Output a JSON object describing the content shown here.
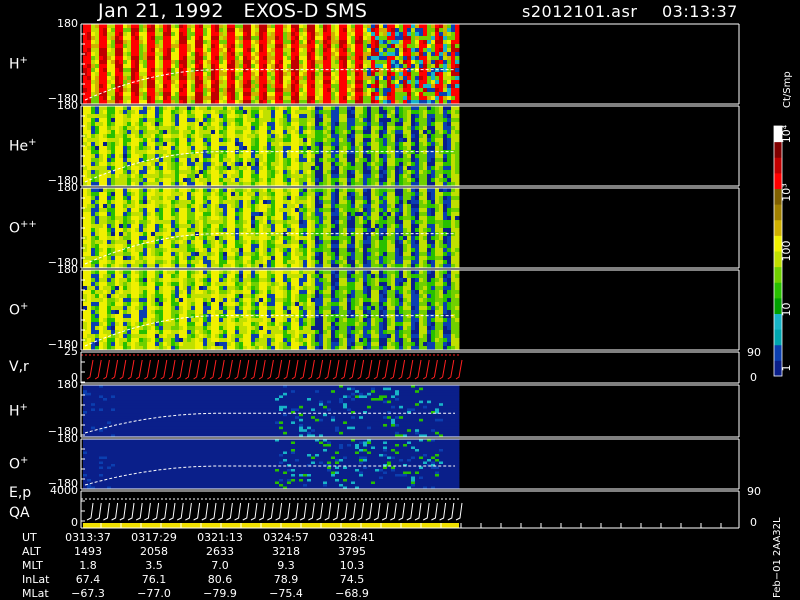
{
  "header": {
    "title": "Jan 21, 1992   EXOS-D SMS",
    "file": "s2012101.asr",
    "time": "03:13:37"
  },
  "colorbar": {
    "unit": "Ct/Smp",
    "ticks": [
      "1",
      "10",
      "100",
      "10³",
      "10⁴"
    ],
    "colors": [
      "#0a1f8a",
      "#0b3fb0",
      "#00a6b0",
      "#18b4c8",
      "#00a000",
      "#28c000",
      "#70d000",
      "#c0e000",
      "#f0f000",
      "#d0b000",
      "#a08000",
      "#806000",
      "#ff0000",
      "#c00000",
      "#800000",
      "#ffffff"
    ]
  },
  "panels": [
    {
      "id": "h-plus",
      "label": "H",
      "sup": "+",
      "ymax": "180",
      "ymin": "−180"
    },
    {
      "id": "he-plus",
      "label": "He",
      "sup": "+",
      "ymax": "180",
      "ymin": "−180"
    },
    {
      "id": "o-plus-plus",
      "label": "O",
      "sup": "++",
      "ymax": "180",
      "ymin": "−180"
    },
    {
      "id": "o-plus",
      "label": "O",
      "sup": "+",
      "ymax": "180",
      "ymin": "−180"
    },
    {
      "id": "v-r",
      "label": "V,r",
      "sup": "",
      "ymax": "25",
      "ymin": "0",
      "rmax": "90",
      "rmin": "0"
    },
    {
      "id": "h-plus-2",
      "label": "H",
      "sup": "+",
      "ymax": "180",
      "ymin": "−180"
    },
    {
      "id": "o-plus-2",
      "label": "O",
      "sup": "+",
      "ymax": "180",
      "ymin": "−180"
    },
    {
      "id": "e-p-qa",
      "label": "E,p",
      "label2": "QA",
      "sup": "",
      "ymax": "4000",
      "ymin": "0",
      "rmax": "90",
      "rmin": "0"
    }
  ],
  "footer": {
    "row_labels": [
      "UT",
      "ALT",
      "MLT",
      "InLat",
      "MLat"
    ],
    "columns": [
      [
        "0313:37",
        "1493",
        "1.8",
        "67.4",
        "−67.3"
      ],
      [
        "0317:29",
        "2058",
        "3.5",
        "76.1",
        "−77.0"
      ],
      [
        "0321:13",
        "2633",
        "7.0",
        "80.6",
        "−79.9"
      ],
      [
        "0324:57",
        "3218",
        "9.3",
        "78.9",
        "−75.4"
      ],
      [
        "0328:41",
        "3795",
        "10.3",
        "74.5",
        "−68.9"
      ]
    ],
    "side_note": "Feb−01 2AA32L"
  },
  "chart_data": {
    "type": "heatmap",
    "title": "Jan 21, 1992   EXOS-D SMS",
    "x_ticks": [
      "0313:37",
      "0317:29",
      "0321:13",
      "0324:57",
      "0328:41"
    ],
    "color_scale": {
      "unit": "Ct/Smp",
      "log": true,
      "range": [
        1,
        10000
      ]
    },
    "series": [
      {
        "name": "H+",
        "ylim": [
          -180,
          180
        ]
      },
      {
        "name": "He+",
        "ylim": [
          -180,
          180
        ]
      },
      {
        "name": "O++",
        "ylim": [
          -180,
          180
        ]
      },
      {
        "name": "O+",
        "ylim": [
          -180,
          180
        ]
      },
      {
        "name": "V,r",
        "ylim": [
          0,
          25
        ],
        "right_ylim": [
          0,
          90
        ]
      },
      {
        "name": "H+",
        "ylim": [
          -180,
          180
        ]
      },
      {
        "name": "O+",
        "ylim": [
          -180,
          180
        ]
      },
      {
        "name": "E,p / QA",
        "ylim": [
          0,
          4000
        ],
        "right_ylim": [
          0,
          90
        ]
      }
    ]
  }
}
